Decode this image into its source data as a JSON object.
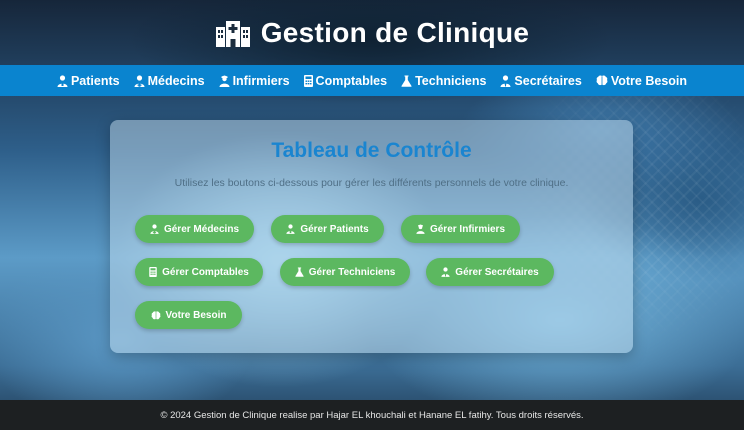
{
  "header": {
    "title": "Gestion de Clinique",
    "logo_icon": "hospital-icon"
  },
  "nav": {
    "items": [
      {
        "label": "Patients",
        "icon": "user-injured-icon"
      },
      {
        "label": "Médecins",
        "icon": "user-doctor-icon"
      },
      {
        "label": "Infirmiers",
        "icon": "user-nurse-icon"
      },
      {
        "label": "Comptables",
        "icon": "calculator-icon"
      },
      {
        "label": "Techniciens",
        "icon": "flask-icon"
      },
      {
        "label": "Secrétaires",
        "icon": "user-tie-icon"
      },
      {
        "label": "Votre Besoin",
        "icon": "brain-icon"
      }
    ]
  },
  "panel": {
    "title": "Tableau de Contrôle",
    "subtitle": "Utilisez les boutons ci-dessous pour gérer les différents personnels de votre clinique.",
    "buttons": [
      {
        "label": "Gérer Médecins",
        "icon": "user-doctor-icon"
      },
      {
        "label": "Gérer Patients",
        "icon": "user-injured-icon"
      },
      {
        "label": "Gérer Infirmiers",
        "icon": "user-nurse-icon"
      },
      {
        "label": "Gérer Comptables",
        "icon": "calculator-icon"
      },
      {
        "label": "Gérer Techniciens",
        "icon": "flask-icon"
      },
      {
        "label": "Gérer Secrétaires",
        "icon": "user-tie-icon"
      },
      {
        "label": "Votre Besoin",
        "icon": "brain-icon"
      }
    ]
  },
  "footer": {
    "text": "© 2024 Gestion de Clinique realise par Hajar EL khouchali et Hanane EL fatihy. Tous droits réservés."
  },
  "colors": {
    "nav_bar": "#0a84cf",
    "accent_title": "#1a85d0",
    "button_green": "#5cb860",
    "footer": "#1d2022"
  }
}
